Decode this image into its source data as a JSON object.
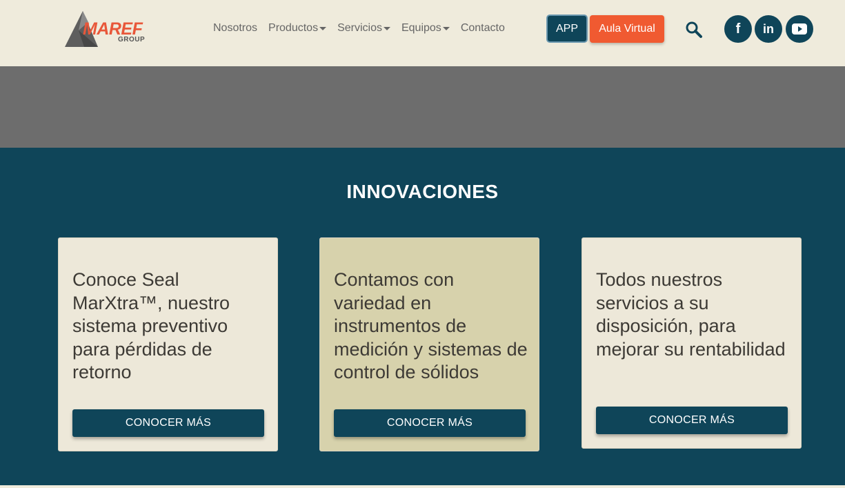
{
  "brand": {
    "name": "MAREF",
    "sub": "GROUP",
    "accent": "#e8573a",
    "primary": "#0f4559"
  },
  "nav": {
    "items": [
      {
        "label": "Nosotros",
        "dropdown": false
      },
      {
        "label": "Productos",
        "dropdown": true
      },
      {
        "label": "Servicios",
        "dropdown": true
      },
      {
        "label": "Equipos",
        "dropdown": true
      },
      {
        "label": "Contacto",
        "dropdown": false
      }
    ]
  },
  "header": {
    "app_label": "APP",
    "aula_label": "Aula Virtual",
    "search_icon": "search-icon",
    "social": [
      "facebook-icon",
      "linkedin-icon",
      "youtube-icon"
    ]
  },
  "section": {
    "title": "INNOVACIONES",
    "cards": [
      {
        "text": "Conoce Seal MarXtra™, nuestro sistema preventivo para pérdidas de retorno",
        "button": "CONOCER MÁS"
      },
      {
        "text": "Contamos con variedad en instrumentos de medición y sistemas de control de sólidos",
        "button": "CONOCER MÁS"
      },
      {
        "text": "Todos nuestros servicios a su disposición, para mejorar su rentabilidad",
        "button": "CONOCER MÁS"
      }
    ]
  }
}
